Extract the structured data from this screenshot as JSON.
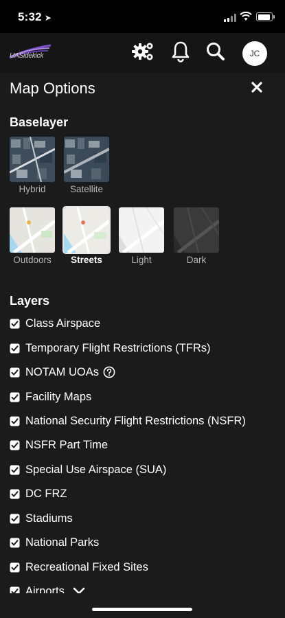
{
  "status": {
    "time": "5:32"
  },
  "header": {
    "logo_text": "UASidekick",
    "avatar_initials": "JC"
  },
  "panel": {
    "title": "Map Options",
    "baselayer_heading": "Baselayer",
    "baselayers": [
      {
        "label": "Hybrid",
        "selected": false
      },
      {
        "label": "Satellite",
        "selected": false
      },
      {
        "label": "Outdoors",
        "selected": false
      },
      {
        "label": "Streets",
        "selected": true
      },
      {
        "label": "Light",
        "selected": false
      },
      {
        "label": "Dark",
        "selected": false
      }
    ],
    "layers_heading": "Layers",
    "layers": [
      {
        "label": "Class Airspace",
        "checked": true
      },
      {
        "label": "Temporary Flight Restrictions (TFRs)",
        "checked": true
      },
      {
        "label": "NOTAM UOAs",
        "checked": true
      },
      {
        "label": "Facility Maps",
        "checked": true
      },
      {
        "label": "National Security Flight Restrictions (NSFR)",
        "checked": true
      },
      {
        "label": "NSFR Part Time",
        "checked": true
      },
      {
        "label": "Special Use Airspace (SUA)",
        "checked": true
      },
      {
        "label": "DC FRZ",
        "checked": true
      },
      {
        "label": "Stadiums",
        "checked": true
      },
      {
        "label": "National Parks",
        "checked": true
      },
      {
        "label": "Recreational Fixed Sites",
        "checked": true
      },
      {
        "label": "Airports",
        "checked": true
      }
    ]
  }
}
